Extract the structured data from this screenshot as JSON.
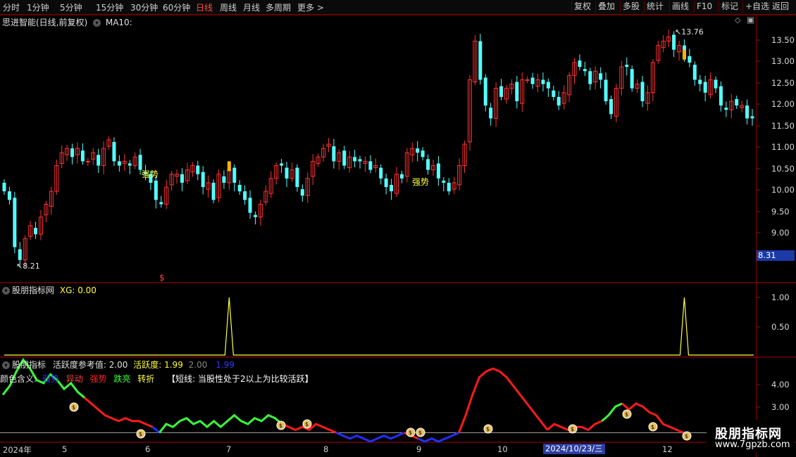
{
  "toolbar": {
    "periods": [
      "分时",
      "1分钟",
      "5分钟",
      "15分钟",
      "30分钟",
      "60分钟",
      "日线",
      "周线",
      "月线",
      "多周期",
      "更多 >"
    ],
    "active_period": "日线",
    "right_buttons": [
      "复权",
      "叠加",
      "多股",
      "统计",
      "画线",
      "F10",
      "标记",
      "+自选",
      "返回"
    ]
  },
  "main_panel": {
    "title": "思进智能(日线,前复权)",
    "indicator": "MA10:",
    "max_label": "13.76",
    "min_label": "8.21",
    "signal_label": "强势",
    "dollar_mark": "$",
    "price_tag": "8.31",
    "y_ticks": [
      "13.50",
      "13.00",
      "12.50",
      "12.00",
      "11.50",
      "11.00",
      "10.50",
      "10.00",
      "9.50",
      "9.00"
    ]
  },
  "xg_panel": {
    "title": "股朋指标网",
    "xg_label": "XG: 0.00",
    "y_ticks": [
      "1.00",
      "0.50"
    ]
  },
  "activity_panel": {
    "title": "股朋指标",
    "ref_label": "活跃度参考值: 2.00",
    "act_label": "活跃度: 1.99",
    "val_grey": "2.00",
    "val_blue": "1.99",
    "legend_prefix": "颜色含义:",
    "legend": [
      {
        "text": "弱势",
        "color": "#2a3cff"
      },
      {
        "text": "异动",
        "color": "#ff4040"
      },
      {
        "text": "强势",
        "color": "#ff2020"
      },
      {
        "text": "跌亮",
        "color": "#39ff39"
      },
      {
        "text": "转折",
        "color": "#ffff40"
      }
    ],
    "note": "【短线: 当股性处于2以上为比较活跃】",
    "y_ticks": [
      "4.00",
      "3.00"
    ]
  },
  "x_axis": {
    "labels": [
      "2024年",
      "5",
      "6",
      "7",
      "8",
      "9",
      "10",
      "11",
      "12"
    ],
    "cursor_date": "2024/10/23/三"
  },
  "watermark": {
    "title": "股朋指标网",
    "url": "www.7gpzb.com"
  },
  "chart_data": [
    {
      "type": "candlestick",
      "title": "思进智能(日线,前复权)",
      "ylim": [
        8.1,
        13.9
      ],
      "max": 13.76,
      "min": 8.21,
      "last": 8.31,
      "closes": [
        9.9,
        9.7,
        8.6,
        8.3,
        8.8,
        9.1,
        8.9,
        9.3,
        9.6,
        9.9,
        10.5,
        10.8,
        10.9,
        10.7,
        10.9,
        10.6,
        10.6,
        10.8,
        10.5,
        10.9,
        11.1,
        10.6,
        10.5,
        10.6,
        10.5,
        10.7,
        10.4,
        10.3,
        10.1,
        9.7,
        9.6,
        10.0,
        10.3,
        10.3,
        10.1,
        10.4,
        10.5,
        10.3,
        10.0,
        10.1,
        9.7,
        10.3,
        10.1,
        10.4,
        10.1,
        9.9,
        9.7,
        9.4,
        9.3,
        9.6,
        9.9,
        10.2,
        10.5,
        10.5,
        10.2,
        10.4,
        10.0,
        9.8,
        10.2,
        10.6,
        10.7,
        10.9,
        11.0,
        10.6,
        10.8,
        10.5,
        10.7,
        10.6,
        10.6,
        10.6,
        10.4,
        10.5,
        10.2,
        10.0,
        9.9,
        10.3,
        10.2,
        10.8,
        10.9,
        10.8,
        10.7,
        10.4,
        10.5,
        10.2,
        10.1,
        9.9,
        10.1,
        10.5,
        11.0,
        12.5,
        13.4,
        12.5,
        11.9,
        11.6,
        12.3,
        12.1,
        12.3,
        12.4,
        12.0,
        12.5,
        12.5,
        12.4,
        12.5,
        12.4,
        12.3,
        12.1,
        11.9,
        12.2,
        12.6,
        12.9,
        12.8,
        12.7,
        12.4,
        12.7,
        12.5,
        12.0,
        11.7,
        12.3,
        12.8,
        12.8,
        12.3,
        12.4,
        12.0,
        12.2,
        12.9,
        13.3,
        13.4,
        13.5,
        13.2,
        13.3,
        13.0,
        12.9,
        12.5,
        12.4,
        12.2,
        12.5,
        12.3,
        11.9,
        11.8,
        12.0,
        11.9,
        11.9,
        11.6,
        11.6
      ]
    },
    {
      "type": "line",
      "title": "XG",
      "ylim": [
        0,
        1.2
      ],
      "spikes_at_index": [
        43,
        130
      ],
      "values_note": "0 everywhere except two spikes to 1.00"
    },
    {
      "type": "line",
      "title": "活跃度",
      "ylim": [
        1.7,
        4.3
      ],
      "reference": 2.0,
      "last": 1.99,
      "segments": [
        {
          "color": "green",
          "values": [
            3.3,
            3.6,
            4.1,
            4.5,
            4.2,
            3.8,
            3.7,
            4.0,
            3.8,
            3.5,
            3.7,
            3.4,
            3.2
          ]
        },
        {
          "color": "red",
          "values": [
            3.2,
            3.0,
            2.8,
            2.6,
            2.5,
            2.4,
            2.5,
            2.4,
            2.4,
            2.3,
            2.2
          ]
        },
        {
          "color": "blue",
          "values": [
            2.2,
            2.0
          ]
        },
        {
          "color": "green",
          "values": [
            2.0,
            2.3,
            2.2,
            2.4,
            2.5,
            2.3,
            2.4,
            2.2,
            2.4,
            2.2,
            2.4,
            2.6,
            2.4,
            2.3,
            2.5,
            2.4,
            2.6,
            2.5,
            2.3
          ]
        },
        {
          "color": "red",
          "values": [
            2.3,
            2.2,
            2.1,
            2.2,
            2.1,
            2.3,
            2.2,
            2.1,
            2.0
          ]
        },
        {
          "color": "blue",
          "values": [
            2.0,
            1.9,
            1.8,
            1.9,
            1.8,
            1.7,
            1.8,
            1.9,
            1.8,
            1.9,
            2.0
          ]
        },
        {
          "color": "red",
          "values": [
            2.0,
            1.9,
            1.8
          ]
        },
        {
          "color": "blue",
          "values": [
            1.8,
            1.7,
            1.8,
            1.7,
            1.8,
            1.9,
            2.0
          ]
        },
        {
          "color": "red",
          "values": [
            2.0,
            2.6,
            3.3,
            3.9,
            4.1,
            4.2,
            4.1,
            3.9,
            3.6,
            3.3,
            3.0,
            2.7,
            2.4,
            2.1
          ]
        },
        {
          "color": "red",
          "values": [
            2.1,
            2.3,
            2.2,
            2.1,
            2.2,
            2.2,
            2.1,
            2.3,
            2.4
          ]
        },
        {
          "color": "green",
          "values": [
            2.4,
            2.6,
            2.9,
            3.0
          ]
        },
        {
          "color": "red",
          "values": [
            3.0,
            2.8,
            3.0,
            2.9,
            2.7,
            2.6
          ]
        },
        {
          "color": "red",
          "values": [
            2.6,
            2.3,
            2.2,
            2.1,
            2.0
          ]
        },
        {
          "color": "blue",
          "values": [
            2.0,
            1.99
          ]
        }
      ]
    }
  ]
}
